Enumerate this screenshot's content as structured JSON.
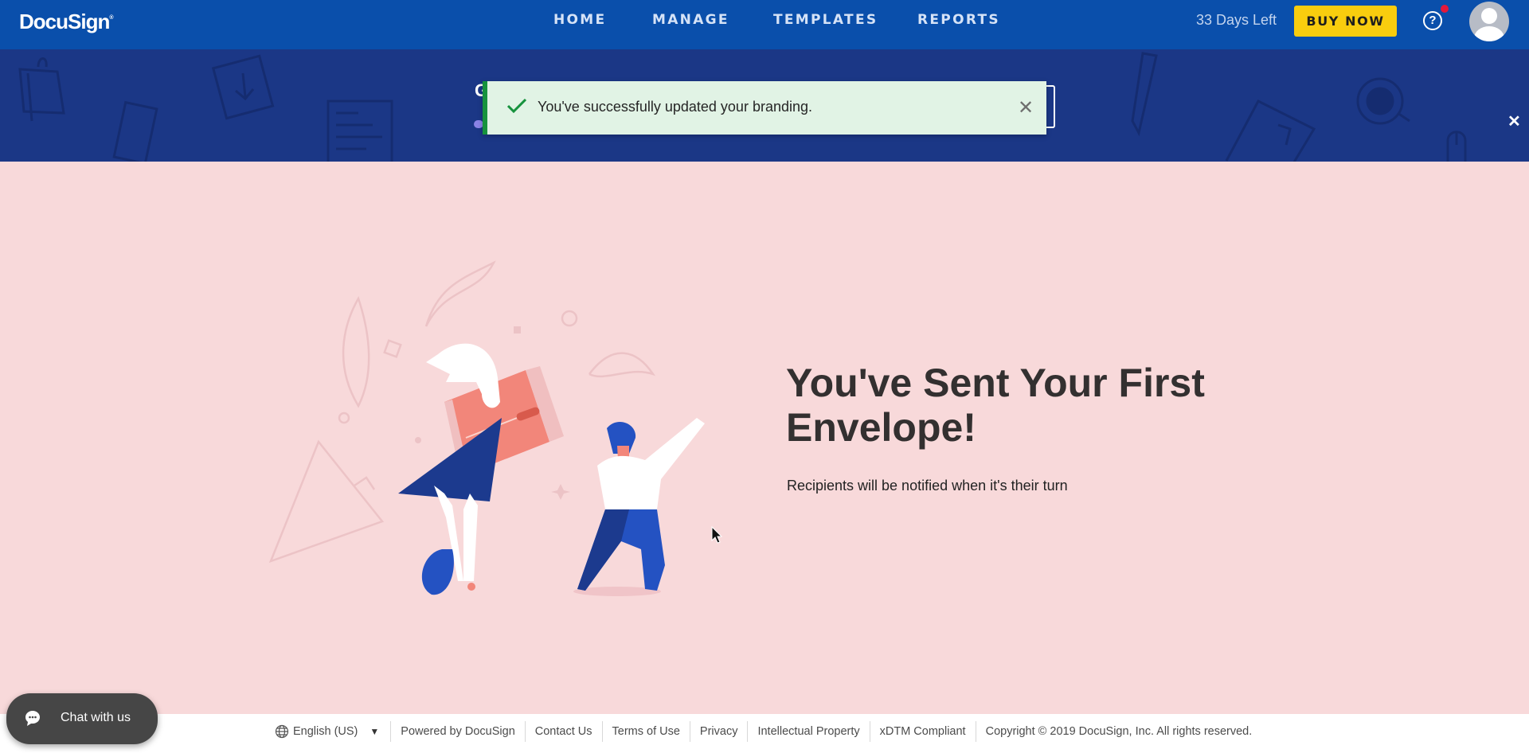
{
  "header": {
    "logo": "DocuSign",
    "nav": [
      {
        "label": "HOME"
      },
      {
        "label": "MANAGE"
      },
      {
        "label": "TEMPLATES"
      },
      {
        "label": "REPORTS"
      }
    ],
    "trial_status": "33 Days Left",
    "buy_button": "BUY NOW",
    "help_icon": "question-circle-icon",
    "help_glyph": "?",
    "avatar_icon": "user-avatar-icon"
  },
  "banner": {
    "close_glyph": "✕",
    "behind_title_fragment": "G"
  },
  "toast": {
    "message": "You've successfully updated your branding.",
    "icon": "checkmark-icon",
    "close_glyph": "✕",
    "accent_color": "#16923d",
    "background_color": "#e1f3e5"
  },
  "main": {
    "title": "You've Sent Your First Envelope!",
    "subtitle": "Recipients will be notified when it's their turn"
  },
  "footer": {
    "language": "English (US)",
    "language_caret": "▼",
    "links": [
      {
        "label": "Powered by DocuSign"
      },
      {
        "label": "Contact Us"
      },
      {
        "label": "Terms of Use"
      },
      {
        "label": "Privacy"
      },
      {
        "label": "Intellectual Property"
      },
      {
        "label": "xDTM Compliant"
      }
    ],
    "copyright": "Copyright © 2019 DocuSign, Inc. All rights reserved."
  },
  "chat": {
    "label": "Chat with us",
    "icon": "chat-bubble-icon"
  },
  "colors": {
    "header_bg": "#0a4fab",
    "banner_bg": "#1b3786",
    "page_bg": "#f8d9da",
    "buy_button": "#f9cd0e",
    "notification_dot": "#e3183a"
  }
}
